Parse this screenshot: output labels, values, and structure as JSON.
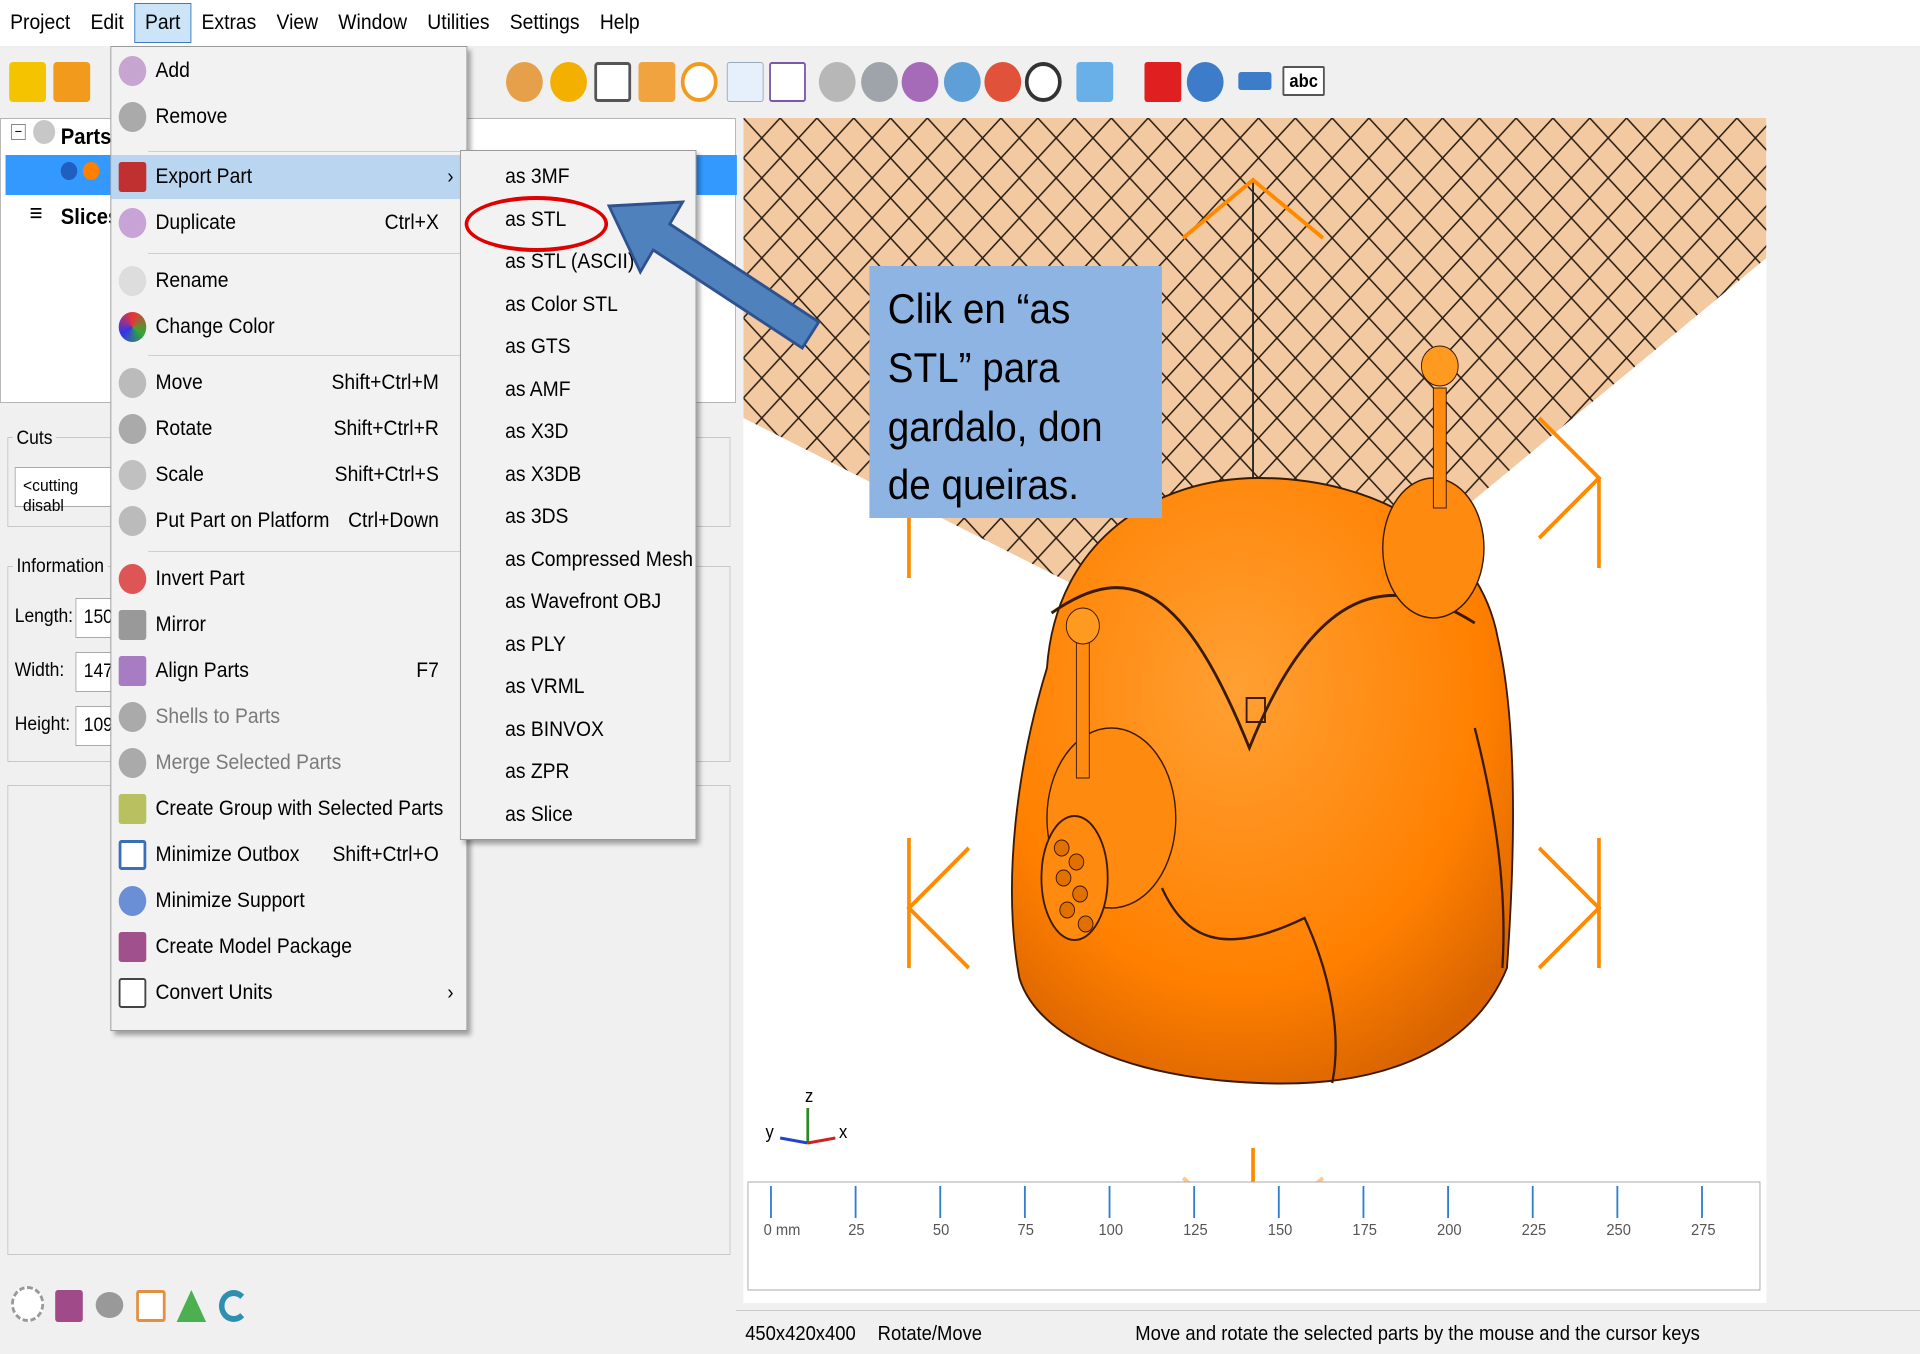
{
  "menubar": {
    "items": [
      "Project",
      "Edit",
      "Part",
      "Extras",
      "View",
      "Window",
      "Utilities",
      "Settings",
      "Help"
    ]
  },
  "tree": {
    "parts": "Parts",
    "slices": "Slices"
  },
  "cuts": {
    "title": "Cuts",
    "select_value": "<cutting disabl"
  },
  "information": {
    "title": "Information",
    "length_label": "Length:",
    "length_value": "150",
    "width_label": "Width:",
    "width_value": "147",
    "height_label": "Height:",
    "height_value": "109"
  },
  "part_menu": {
    "items": [
      {
        "label": "Add",
        "shortcut": ""
      },
      {
        "label": "Remove",
        "shortcut": ""
      },
      {
        "label": "Export Part",
        "shortcut": ""
      },
      {
        "label": "Duplicate",
        "shortcut": "Ctrl+X"
      },
      {
        "label": "Rename",
        "shortcut": ""
      },
      {
        "label": "Change Color",
        "shortcut": ""
      },
      {
        "label": "Move",
        "shortcut": "Shift+Ctrl+M"
      },
      {
        "label": "Rotate",
        "shortcut": "Shift+Ctrl+R"
      },
      {
        "label": "Scale",
        "shortcut": "Shift+Ctrl+S"
      },
      {
        "label": "Put Part on Platform",
        "shortcut": "Ctrl+Down"
      },
      {
        "label": "Invert Part",
        "shortcut": ""
      },
      {
        "label": "Mirror",
        "shortcut": ""
      },
      {
        "label": "Align Parts",
        "shortcut": "F7"
      },
      {
        "label": "Shells to Parts",
        "shortcut": ""
      },
      {
        "label": "Merge Selected Parts",
        "shortcut": ""
      },
      {
        "label": "Create Group with Selected Parts",
        "shortcut": ""
      },
      {
        "label": "Minimize Outbox",
        "shortcut": "Shift+Ctrl+O"
      },
      {
        "label": "Minimize Support",
        "shortcut": ""
      },
      {
        "label": "Create Model Package",
        "shortcut": ""
      },
      {
        "label": "Convert Units",
        "shortcut": ""
      }
    ]
  },
  "export_menu": {
    "items": [
      "as 3MF",
      "as STL",
      "as STL (ASCII)",
      "as Color STL",
      "as GTS",
      "as AMF",
      "as X3D",
      "as X3DB",
      "as 3DS",
      "as Compressed Mesh",
      "as Wavefront OBJ",
      "as PLY",
      "as VRML",
      "as BINVOX",
      "as ZPR",
      "as Slice"
    ]
  },
  "callout": {
    "lines": [
      "Clik en “as",
      "STL” para",
      "gardalo, don",
      "de queiras."
    ]
  },
  "viewport": {
    "axis_x": "x",
    "axis_y": "y",
    "axis_z": "z",
    "ruler_labels": [
      "0 mm",
      "25",
      "50",
      "75",
      "100",
      "125",
      "150",
      "175",
      "200",
      "225",
      "250",
      "275"
    ]
  },
  "toolbar": {
    "text_icon": "abc"
  },
  "statusbar": {
    "size": "450x420x400",
    "mode": "Rotate/Move",
    "hint": "Move and rotate the selected parts by the mouse and the cursor keys"
  },
  "colors": {
    "model": "#ff8000",
    "callout": "#8eb4e3",
    "highlight": "#cce4f7",
    "ring": "#e00000",
    "arrow": "#4f81bd"
  }
}
